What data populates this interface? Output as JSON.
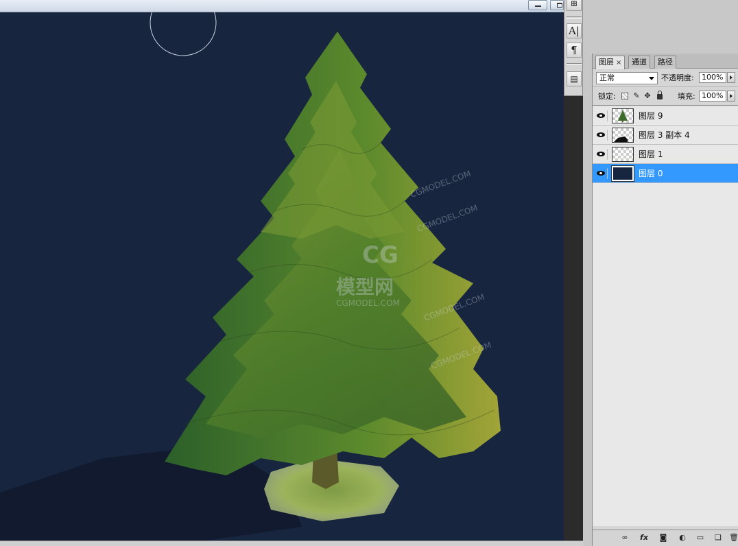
{
  "layers_panel": {
    "tabs": [
      {
        "label": "图层",
        "close": "×"
      },
      {
        "label": "通道"
      },
      {
        "label": "路径"
      }
    ],
    "blend_mode": "正常",
    "opacity_label": "不透明度:",
    "opacity_value": "100%",
    "lock_label": "锁定:",
    "fill_label": "填充:",
    "fill_value": "100%",
    "layers": [
      {
        "name": "图层 9",
        "visible": true,
        "selected": false,
        "thumb": "tree"
      },
      {
        "name": "图层 3 副本 4",
        "visible": true,
        "selected": false,
        "thumb": "shadow"
      },
      {
        "name": "图层 1",
        "visible": true,
        "selected": false,
        "thumb": "transparent"
      },
      {
        "name": "图层 0",
        "visible": true,
        "selected": true,
        "thumb": "navy"
      }
    ],
    "bottom_icons": [
      "link-icon",
      "fx-icon",
      "mask-icon",
      "adjustment-icon",
      "folder-icon",
      "new-layer-icon",
      "trash-icon"
    ],
    "fx_label": "fx"
  },
  "dock": {
    "icons": [
      "tool-presets-icon",
      "character-icon",
      "paragraph-icon",
      "layer-comps-icon"
    ],
    "character_glyph": "A|",
    "paragraph_glyph": "¶"
  },
  "canvas": {
    "background": "#18253f",
    "watermark_main": "CG",
    "watermark_sub": "模型网",
    "watermark_url": "CGMODEL.COM"
  },
  "colors": {
    "selection": "#3399ff",
    "canvas": "#18253f"
  }
}
